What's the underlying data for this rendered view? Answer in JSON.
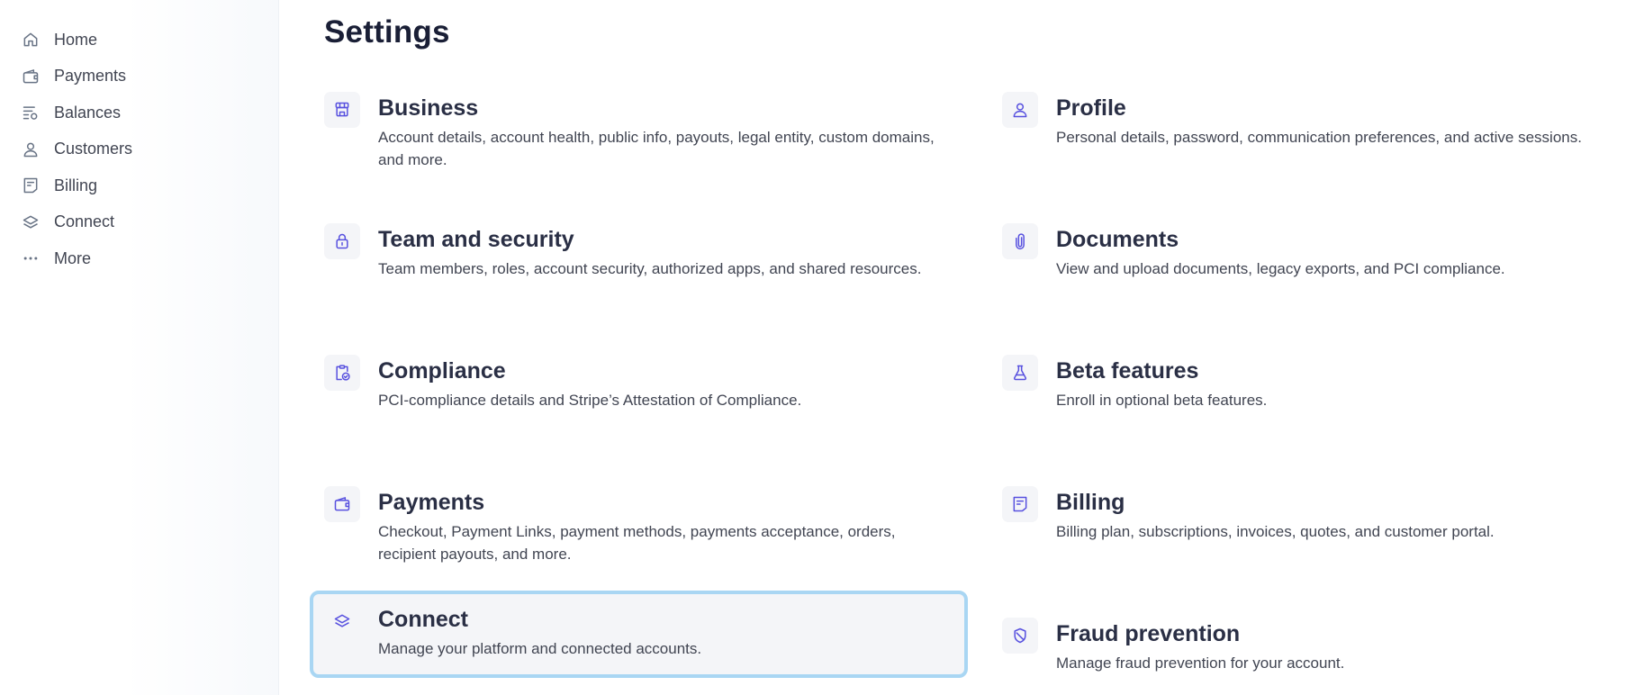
{
  "sidebar": {
    "items": [
      {
        "label": "Home",
        "icon": "home-icon"
      },
      {
        "label": "Payments",
        "icon": "wallet-icon"
      },
      {
        "label": "Balances",
        "icon": "balances-icon"
      },
      {
        "label": "Customers",
        "icon": "person-icon"
      },
      {
        "label": "Billing",
        "icon": "receipt-icon"
      },
      {
        "label": "Connect",
        "icon": "layers-icon"
      },
      {
        "label": "More",
        "icon": "more-icon"
      }
    ]
  },
  "page": {
    "title": "Settings"
  },
  "cards": [
    {
      "title": "Business",
      "desc": "Account details, account health, public info, payouts, legal entity, custom domains, and more.",
      "icon": "storefront-icon"
    },
    {
      "title": "Profile",
      "desc": "Personal details, password, communication preferences, and active sessions.",
      "icon": "person-icon"
    },
    {
      "title": "Team and security",
      "desc": "Team members, roles, account security, authorized apps, and shared resources.",
      "icon": "lock-icon"
    },
    {
      "title": "Documents",
      "desc": "View and upload documents, legacy exports, and PCI compliance.",
      "icon": "paperclip-icon"
    },
    {
      "title": "Compliance",
      "desc": "PCI-compliance details and Stripe’s Attestation of Compliance.",
      "icon": "clipboard-check-icon"
    },
    {
      "title": "Beta features",
      "desc": "Enroll in optional beta features.",
      "icon": "flask-icon"
    },
    {
      "title": "Payments",
      "desc": "Checkout, Payment Links, payment methods, payments acceptance, orders, recipient payouts, and more.",
      "icon": "wallet-icon"
    },
    {
      "title": "Billing",
      "desc": "Billing plan, subscriptions, invoices, quotes, and customer portal.",
      "icon": "receipt-icon"
    },
    {
      "title": "Connect",
      "desc": "Manage your platform and connected accounts.",
      "icon": "layers-icon"
    },
    {
      "title": "Fraud prevention",
      "desc": "Manage fraud prevention for your account.",
      "icon": "shield-icon"
    }
  ],
  "colors": {
    "accent": "#5851df",
    "focus_ring": "#a9d6f3",
    "sidebar_icon": "#687385",
    "title_text": "#1a1f36",
    "body_text": "#414552"
  }
}
